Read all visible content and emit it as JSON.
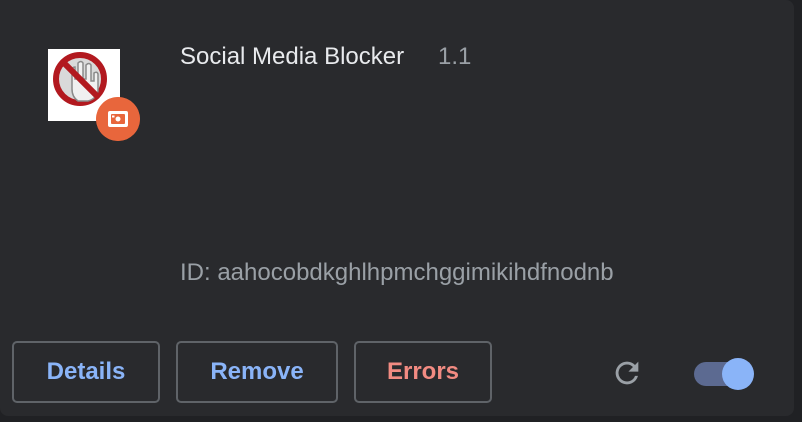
{
  "extension": {
    "name": "Social Media Blocker",
    "version": "1.1",
    "id_text": "ID: aahocobdkghlhpmchggimikihdfnodnb",
    "icon": "blocked-hand-icon",
    "source_badge_icon": "unpacked-extension-icon",
    "enabled": true
  },
  "actions": {
    "details_label": "Details",
    "remove_label": "Remove",
    "errors_label": "Errors",
    "reload_icon": "reload-icon"
  },
  "colors": {
    "background": "#202124",
    "card": "#292a2d",
    "text_primary": "#e8eaed",
    "text_secondary": "#9aa0a6",
    "link_blue": "#8ab4f8",
    "error_red": "#f28b82",
    "badge_orange": "#e8663c",
    "toggle_track": "#5c6a91"
  }
}
